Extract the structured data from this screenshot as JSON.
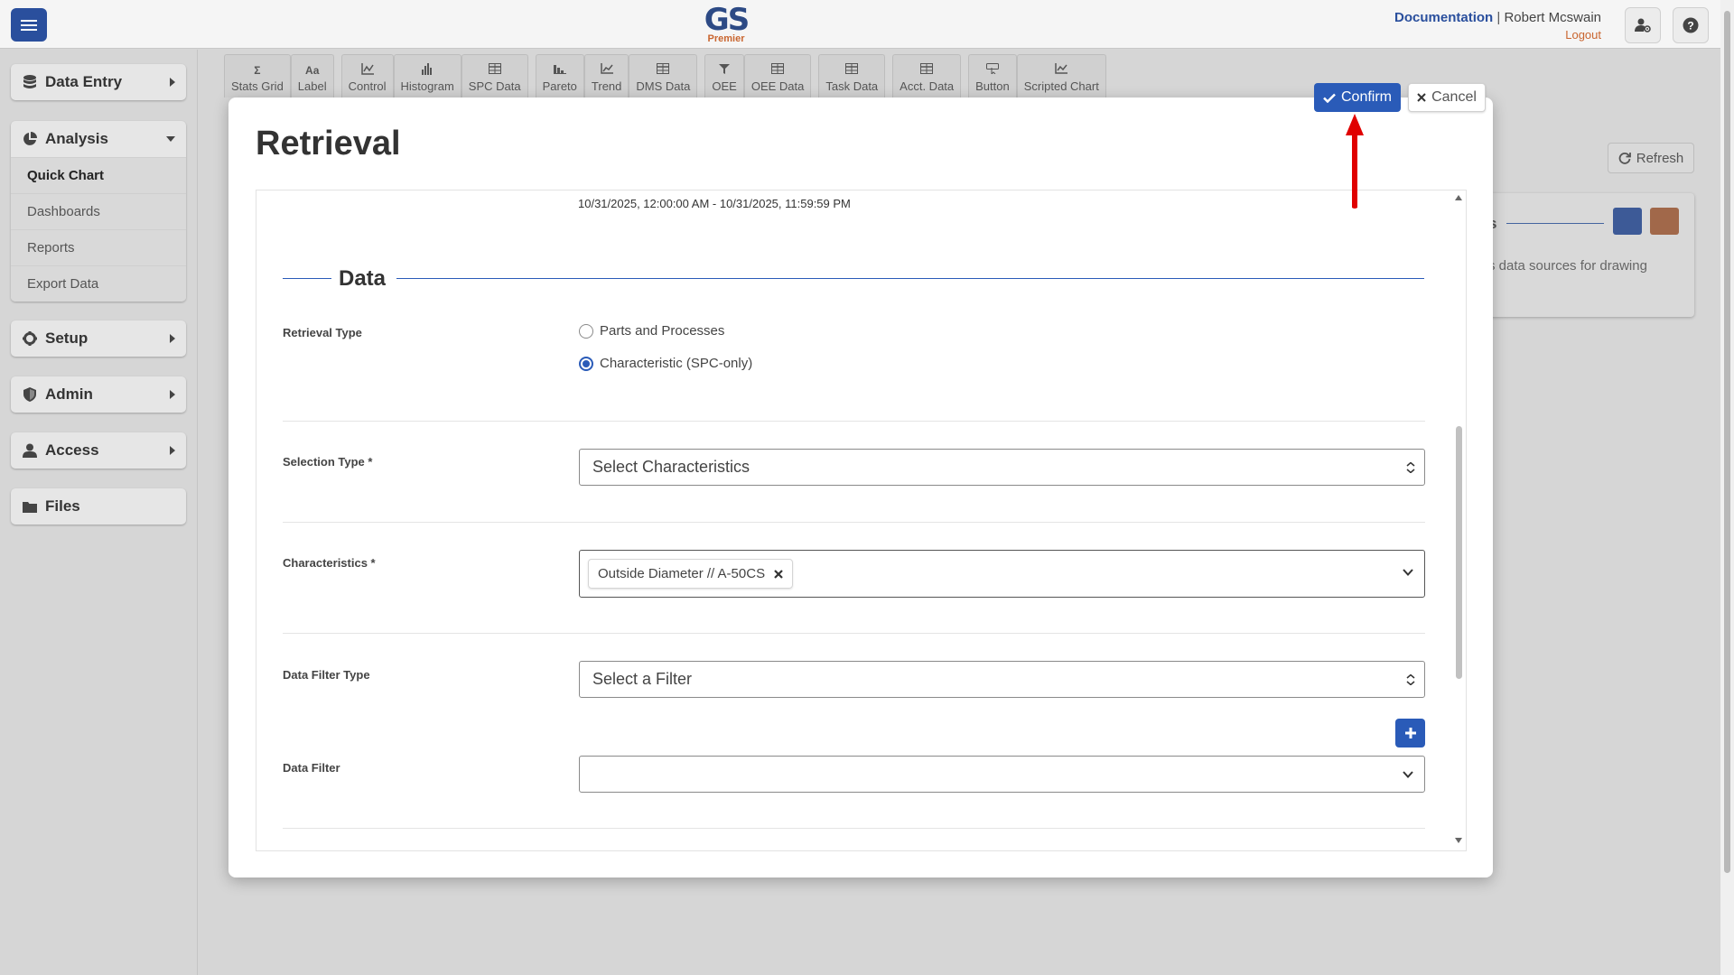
{
  "header": {
    "logo_main": "GS",
    "logo_sub": "Premier",
    "documentation_link": "Documentation",
    "separator": "|",
    "user_name": "Robert Mcswain",
    "logout_link": "Logout"
  },
  "sidebar": {
    "data_entry": "Data Entry",
    "analysis": "Analysis",
    "analysis_items": [
      "Quick Chart",
      "Dashboards",
      "Reports",
      "Export Data"
    ],
    "setup": "Setup",
    "admin": "Admin",
    "access": "Access",
    "files": "Files"
  },
  "toolbar": {
    "items": [
      {
        "icon": "Σ",
        "label": "Stats Grid"
      },
      {
        "icon": "Aa",
        "label": "Label"
      },
      {
        "icon": "control-chart-icon",
        "label": "Control"
      },
      {
        "icon": "histogram-icon",
        "label": "Histogram"
      },
      {
        "icon": "table-icon",
        "label": "SPC Data"
      },
      {
        "icon": "pareto-icon",
        "label": "Pareto"
      },
      {
        "icon": "trend-icon",
        "label": "Trend"
      },
      {
        "icon": "table-icon",
        "label": "DMS Data"
      },
      {
        "icon": "oee-icon",
        "label": "OEE"
      },
      {
        "icon": "table-icon",
        "label": "OEE Data"
      },
      {
        "icon": "table-icon",
        "label": "Task Data"
      },
      {
        "icon": "table-icon",
        "label": "Acct. Data"
      },
      {
        "icon": "button-icon",
        "label": "Button"
      },
      {
        "icon": "scripted-chart-icon",
        "label": "Scripted Chart"
      }
    ]
  },
  "background": {
    "refresh_label": "Refresh",
    "panel_title_fragment": "s",
    "panel_text": "s data sources for drawing"
  },
  "modal": {
    "title": "Retrieval",
    "confirm_label": "Confirm",
    "cancel_label": "Cancel",
    "date_range": "10/31/2025, 12:00:00 AM - 10/31/2025, 11:59:59 PM",
    "section_title": "Data",
    "retrieval_type_label": "Retrieval Type",
    "retrieval_options": [
      "Parts and Processes",
      "Characteristic (SPC-only)"
    ],
    "retrieval_selected": "Characteristic (SPC-only)",
    "selection_type_label": "Selection Type *",
    "selection_type_value": "Select Characteristics",
    "characteristics_label": "Characteristics *",
    "characteristics_tags": [
      "Outside Diameter // A-50CS"
    ],
    "data_filter_type_label": "Data Filter Type",
    "data_filter_type_value": "Select a Filter",
    "data_filter_label": "Data Filter",
    "data_filter_value": ""
  },
  "colors": {
    "primary": "#2a5bb8",
    "brand_orange": "#c9652f",
    "annotation_arrow": "#e00000"
  }
}
